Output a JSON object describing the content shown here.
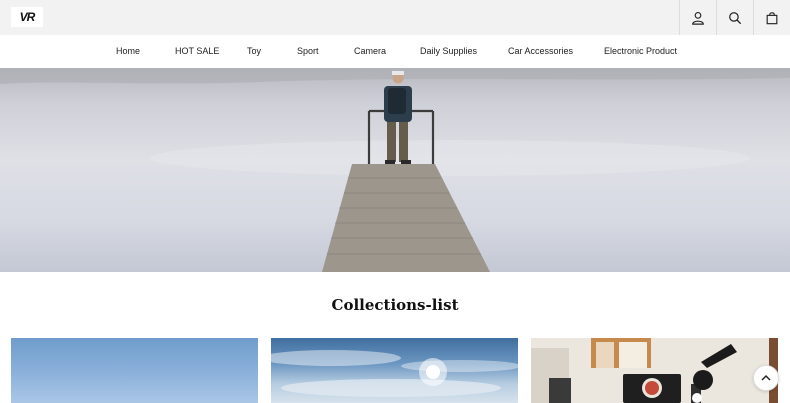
{
  "header": {
    "logo_text": "VR",
    "icons": [
      "user-icon",
      "search-icon",
      "cart-icon"
    ]
  },
  "nav": {
    "items": [
      {
        "label": "Home"
      },
      {
        "label": "HOT SALE"
      },
      {
        "label": "Toy"
      },
      {
        "label": "Sport"
      },
      {
        "label": "Camera"
      },
      {
        "label": "Daily Supplies"
      },
      {
        "label": "Car Accessories"
      },
      {
        "label": "Electronic Product"
      }
    ]
  },
  "main": {
    "section_title": "Collections-list"
  },
  "colors": {
    "topbar_bg": "#f2f2f2",
    "text": "#222222"
  }
}
